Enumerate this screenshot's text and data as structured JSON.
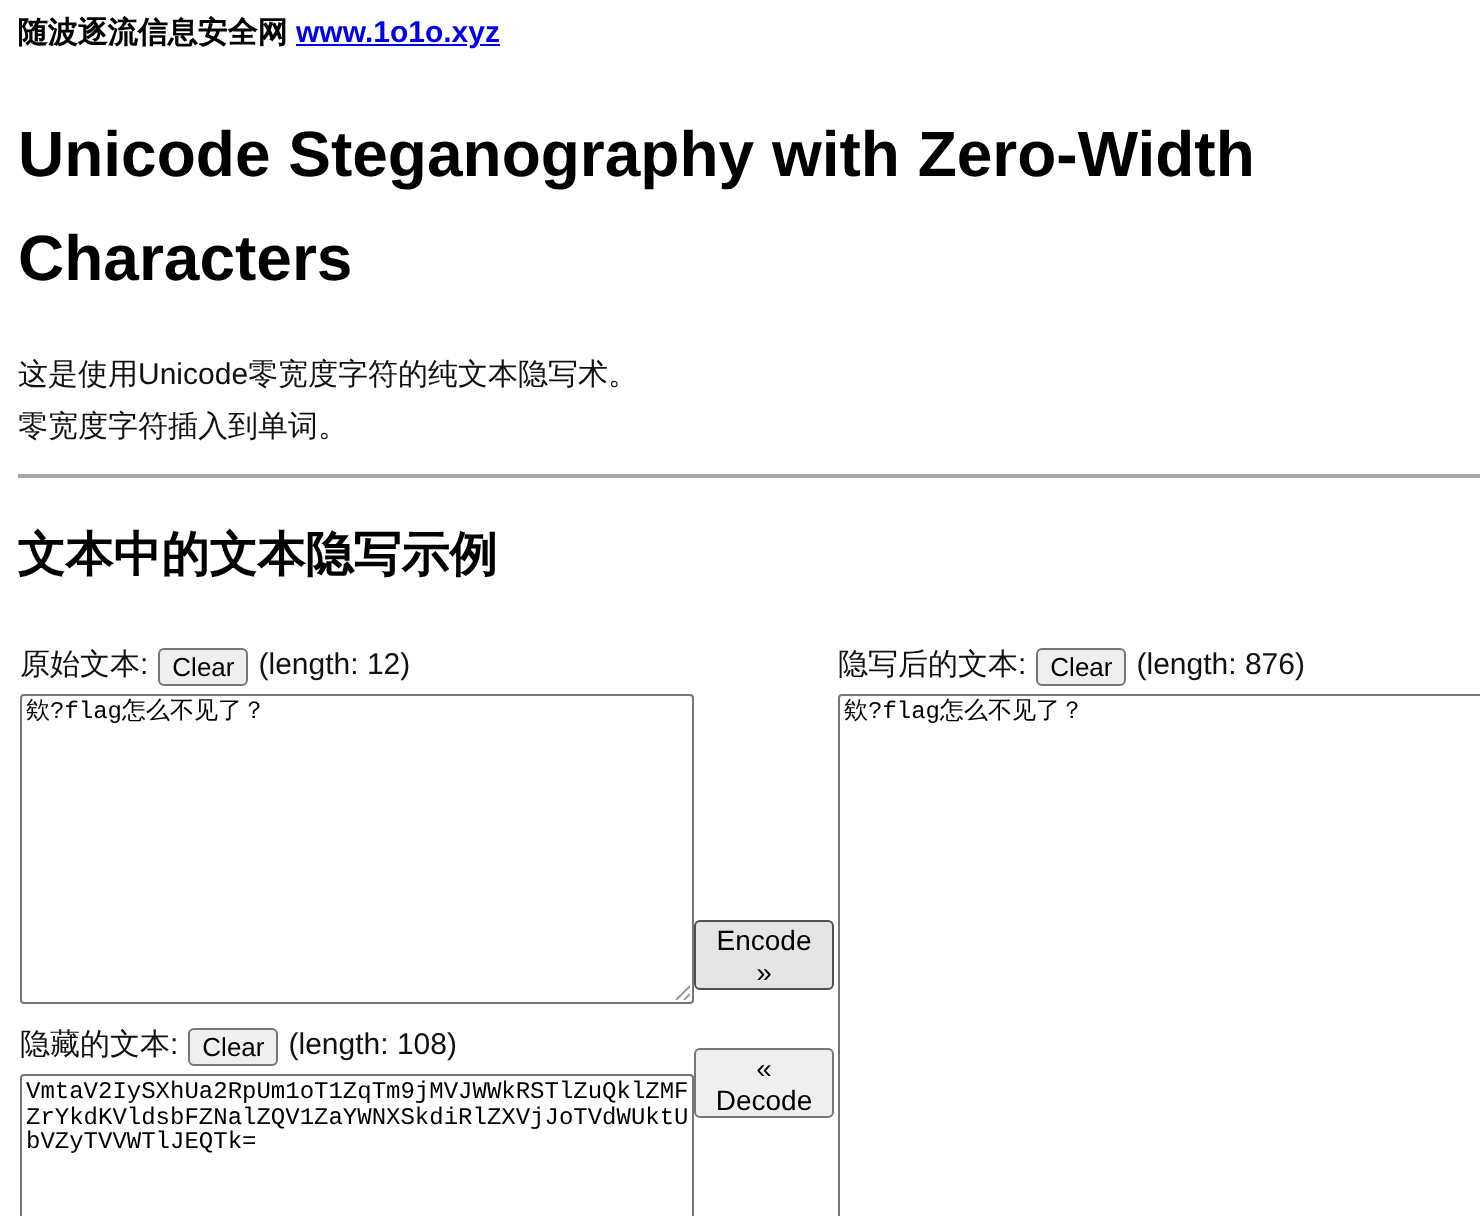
{
  "header": {
    "site_name": "随波逐流信息安全网",
    "link": "www.1o1o.xyz"
  },
  "title": "Unicode Steganography with Zero-Width Characters",
  "intro": [
    "这是使用Unicode零宽度字符的纯文本隐写术。",
    "零宽度字符插入到单词。"
  ],
  "section_title": "文本中的文本隐写示例",
  "original": {
    "label": "原始文本:",
    "clear_button": "Clear",
    "length": "(length: 12)",
    "value": "欸?flag怎么不见了？"
  },
  "hidden": {
    "label": "隐藏的文本:",
    "clear_button": "Clear",
    "length": "(length: 108)",
    "value": "VmtaV2IySXhUa2RpUm1oT1ZqTm9jMVJWWkRSTlZuQklZMFZrYkdKVldsbFZNalZQV1ZaYWNXSkdiRlZXVjJoTVdWUktUbVZyTVVWTlJEQTk="
  },
  "encoded": {
    "label": "隐写后的文本:",
    "clear_button": "Clear",
    "length": "(length: 876)",
    "value": "欸?flag怎么不见了？"
  },
  "actions": [
    {
      "label": "Encode »",
      "hovered": true
    },
    {
      "label": "« Decode",
      "hovered": false
    }
  ]
}
